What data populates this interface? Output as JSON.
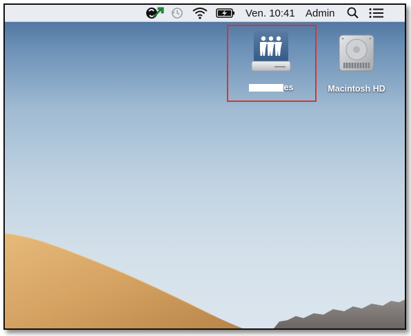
{
  "menubar": {
    "clock": "Ven. 10:41",
    "user": "Admin",
    "icons": [
      "sync-app-icon",
      "timemachine-icon",
      "wifi-icon",
      "battery-charging-icon",
      "search-icon",
      "control-center-icon"
    ]
  },
  "desktop": {
    "shared_volume": {
      "label_visible_suffix": "es",
      "icon": "shared-folder-drive-icon",
      "selected": true
    },
    "macintosh_hd": {
      "label": "Macintosh HD",
      "icon": "hard-drive-icon"
    }
  },
  "colors": {
    "selection_border": "#e0322b",
    "menubar_bg": "#e9ecf0",
    "sand": "#d9a868"
  }
}
